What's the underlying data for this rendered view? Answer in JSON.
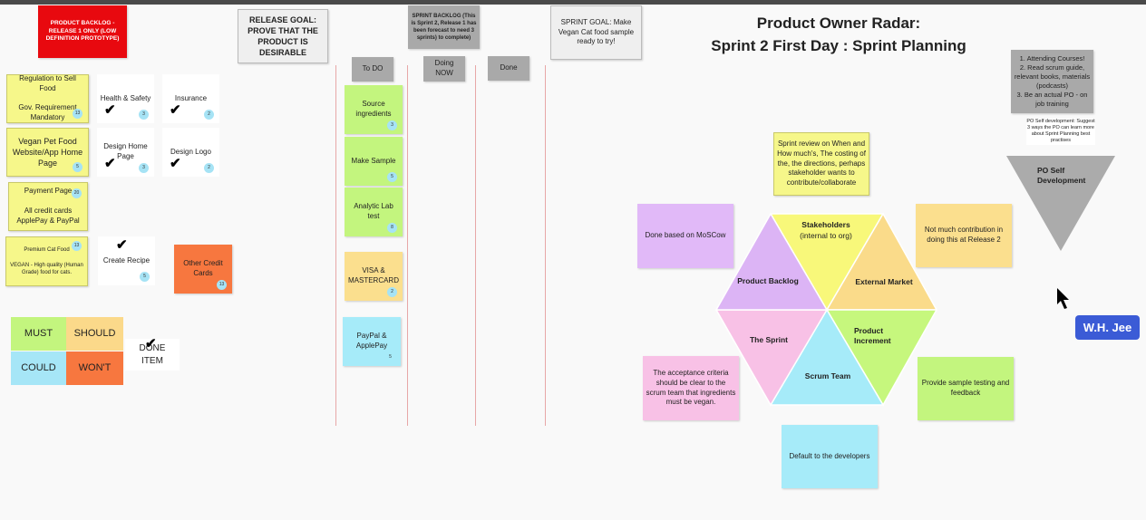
{
  "title": {
    "line1": "Product Owner Radar:",
    "line2": "Sprint 2 First Day : Sprint Planning"
  },
  "product_backlog": {
    "header": "PRODUCT BACKLOG  - RELEASE 1 ONLY (LOW DEFINITION PROTOTYPE)",
    "items": [
      {
        "text": "Regulation to Sell Food\n\nGov. Requirement Mandatory",
        "points": "13",
        "done": false
      },
      {
        "text": "Health & Safety",
        "points": "3",
        "done": true
      },
      {
        "text": "Insurance",
        "points": "2",
        "done": true
      },
      {
        "text": "Vegan Pet Food Website/App Home Page",
        "points": "5",
        "done": false
      },
      {
        "text": "Design Home Page",
        "points": "3",
        "done": true
      },
      {
        "text": "Design Logo",
        "points": "2",
        "done": true
      },
      {
        "text": "Payment Page\n\nAll credit cards ApplePay & PayPal",
        "points": "20",
        "done": false
      },
      {
        "text": "Premium Cat Food\n\nVEGAN - High quality (Human Grade) food for cats.",
        "points": "13",
        "done": false
      },
      {
        "text": "Create Recipe",
        "points": "5",
        "done": true
      },
      {
        "text": "Other Credit Cards",
        "points": "13",
        "done": false
      }
    ]
  },
  "legend": {
    "must": "MUST",
    "should": "SHOULD",
    "could": "COULD",
    "wont": "WON'T",
    "done_item": "DONE ITEM"
  },
  "release_goal": "RELEASE GOAL: PROVE THAT THE PRODUCT IS DESIRABLE",
  "sprint_backlog": {
    "header": "SPRINT BACKLOG (This is Sprint 2, Release 1 has been forecast to need 3 sprints) to complete)",
    "columns": [
      "To DO",
      "Doing NOW",
      "Done"
    ],
    "todo": [
      {
        "text": "Source ingredients",
        "points": "3"
      },
      {
        "text": "Make Sample",
        "points": "5"
      },
      {
        "text": "Analytic Lab test",
        "points": "8"
      },
      {
        "text": "VISA & MASTERCARD",
        "points": "2"
      },
      {
        "text": "PayPal & ApplePay",
        "points": "5"
      }
    ]
  },
  "sprint_goal": "SPRINT GOAL: Make Vegan Cat food sample ready to try!",
  "radar": {
    "segments": [
      "Stakeholders",
      "(internal to org)",
      "External Market",
      "Product",
      "Increment",
      "Scrum Team",
      "The Sprint",
      "Product Backlog"
    ],
    "notes": {
      "stakeholders": "Sprint review on When and How much's, The costing of the, the directions, perhaps stakeholder wants to contribute/collaborate",
      "product_backlog": "Done based on MoSCow",
      "external_market": "Not much contribution in doing this at Release 2",
      "sprint": "The acceptance criteria should be clear to the scrum team that ingredients must be vegan.",
      "increment": "Provide sample testing and feedback",
      "scrum_team": "Default to the developers"
    },
    "colors": {
      "stakeholders": "#f8f87a",
      "external_market": "#fadb8a",
      "increment": "#c6f77d",
      "scrum_team": "#a6ebf9",
      "sprint": "#f8c1e6",
      "backlog": "#dcb4f5"
    }
  },
  "po_self": {
    "ways": "1. Attending Courses!\n2. Read scrum guide, relevant books, materials (podcasts)\n3. Be an actual PO - on job training",
    "prompt": "PO Self development: Suggest 3 ways the PO can learn more about Sprint Planning best practises",
    "label": "PO Self Development"
  },
  "cursor_user": "W.H. Jee"
}
